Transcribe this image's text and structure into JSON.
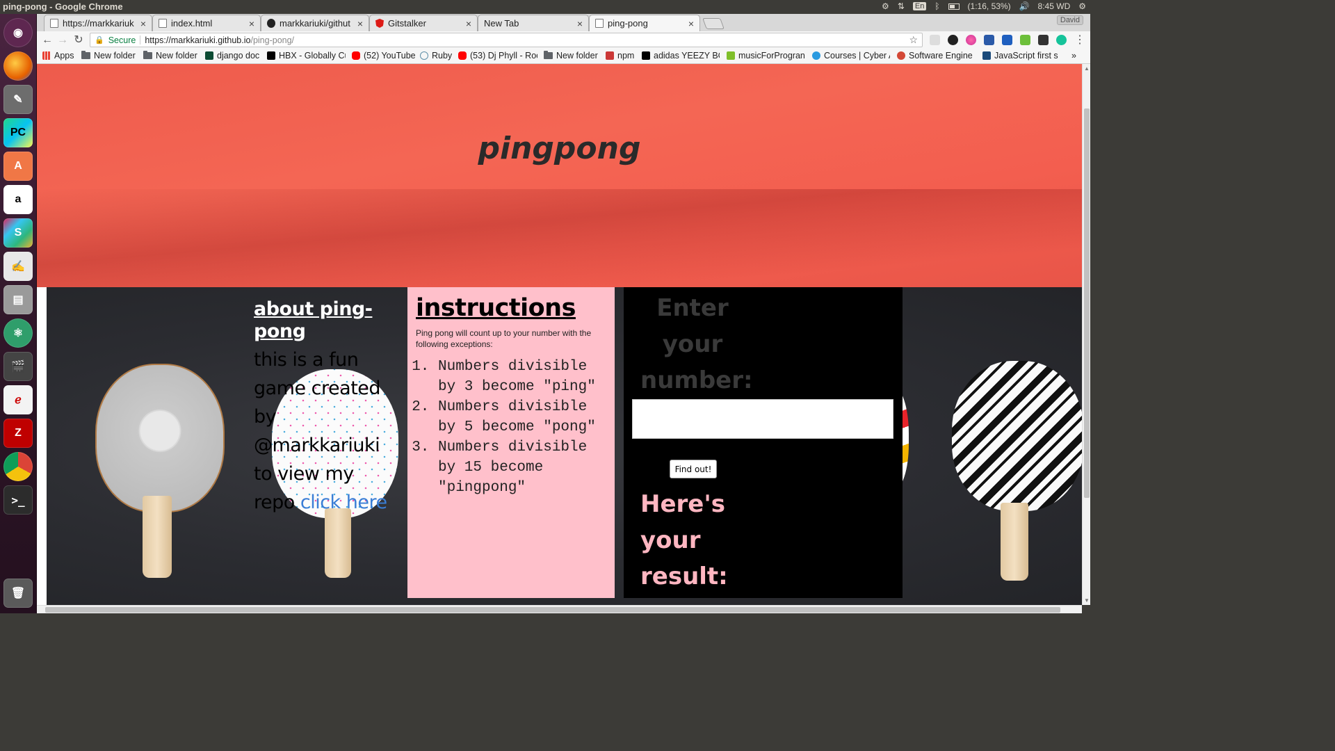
{
  "system": {
    "window_title": "ping-pong - Google Chrome",
    "lang": "En",
    "battery": "(1:16, 53%)",
    "clock": "8:45 WD"
  },
  "browser": {
    "profile": "David",
    "tabs": [
      {
        "label": "https://markkariuk",
        "icon": "page-icon"
      },
      {
        "label": "index.html",
        "icon": "page-icon"
      },
      {
        "label": "markkariuki/githut",
        "icon": "github-icon"
      },
      {
        "label": "Gitstalker",
        "icon": "angular-icon"
      },
      {
        "label": "New Tab",
        "icon": "none"
      },
      {
        "label": "ping-pong",
        "icon": "page-icon",
        "active": true
      }
    ],
    "address": {
      "secure_label": "Secure",
      "url_host": "https://markkariuki.github.io",
      "url_path": "/ping-pong/"
    },
    "bookmarks": [
      {
        "label": "Apps",
        "icon": "apps-grid-icon",
        "color": "#e94235"
      },
      {
        "label": "New folder",
        "icon": "folder-icon"
      },
      {
        "label": "New folder",
        "icon": "folder-icon"
      },
      {
        "label": "django doc",
        "icon": "django-icon",
        "color": "#0c4b33"
      },
      {
        "label": "HBX - Globally Cu",
        "icon": "hbx-icon",
        "color": "#000000"
      },
      {
        "label": "(52) YouTube",
        "icon": "youtube-icon",
        "color": "#ff0000"
      },
      {
        "label": "Ruby",
        "icon": "ruby-icon",
        "color": "#5f8fa8"
      },
      {
        "label": "(53) Dj Phyll - Roc",
        "icon": "youtube-icon",
        "color": "#ff0000"
      },
      {
        "label": "New folder",
        "icon": "folder-icon"
      },
      {
        "label": "npm",
        "icon": "npm-icon",
        "color": "#cb3837"
      },
      {
        "label": "adidas YEEZY BC",
        "icon": "adidas-icon",
        "color": "#000000"
      },
      {
        "label": "musicForProgran",
        "icon": "music-icon",
        "color": "#7fbf2a"
      },
      {
        "label": "Courses | Cyber A",
        "icon": "courses-icon",
        "color": "#2a9ae0"
      },
      {
        "label": "Software Engine",
        "icon": "google-icon",
        "color": "#d34836"
      },
      {
        "label": "JavaScript first s",
        "icon": "js-icon",
        "color": "#1a4a7a"
      }
    ]
  },
  "page": {
    "hero_title": "pingpong",
    "about": {
      "heading": "about ping-pong",
      "body": "this is a fun game created by @markkariuki to view my repo ",
      "link_text": "click here"
    },
    "instructions": {
      "heading": "instructions",
      "intro": "Ping pong will count up to your number with the following exceptions:",
      "items": [
        "Numbers divisible by 3 become \"ping\"",
        "Numbers divisible by 5 become \"pong\"",
        "Numbers divisible by 15 become \"pingpong\""
      ]
    },
    "form": {
      "label": "Enter your number:",
      "input_value": "",
      "button_label": "Find out!",
      "result_label": "Here's your result:"
    }
  },
  "colors": {
    "hero_bg": "#f35e4f",
    "instructions_bg": "#ffc0cb",
    "form_bg": "#000000",
    "result_text": "#ffb6c1",
    "link": "#3a7ed6"
  }
}
